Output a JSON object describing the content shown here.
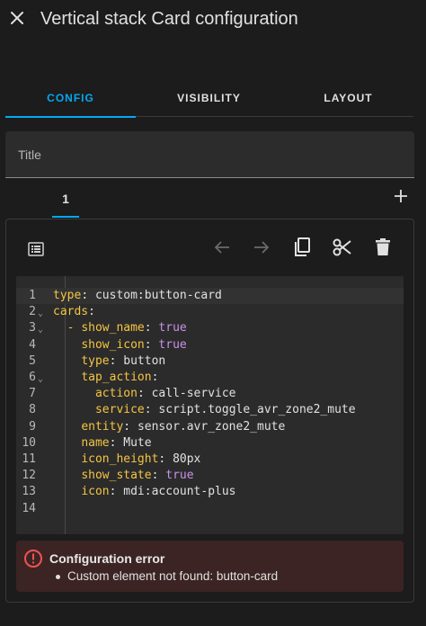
{
  "header": {
    "title": "Vertical stack Card configuration",
    "close_icon": "close-icon"
  },
  "tabs": [
    {
      "label": "CONFIG",
      "active": true
    },
    {
      "label": "VISIBILITY",
      "active": false
    },
    {
      "label": "LAYOUT",
      "active": false
    }
  ],
  "title_field": {
    "placeholder": "Title",
    "value": ""
  },
  "card_tabs": [
    {
      "label": "1",
      "active": true
    }
  ],
  "toolbar": {
    "icons": [
      "list-editor-icon",
      "arrow-left-icon",
      "arrow-right-icon",
      "copy-icon",
      "cut-icon",
      "delete-icon"
    ]
  },
  "editor": {
    "lines": [
      {
        "n": "1",
        "fold": "",
        "indent": "",
        "dash": "",
        "key": "type",
        "value": "custom:button-card",
        "vtype": "str"
      },
      {
        "n": "2",
        "fold": "⌄",
        "indent": "",
        "dash": "",
        "key": "cards",
        "value": "",
        "vtype": "str"
      },
      {
        "n": "3",
        "fold": "⌄",
        "indent": "  ",
        "dash": "- ",
        "key": "show_name",
        "value": "true",
        "vtype": "bool"
      },
      {
        "n": "4",
        "fold": "",
        "indent": "    ",
        "dash": "",
        "key": "show_icon",
        "value": "true",
        "vtype": "bool"
      },
      {
        "n": "5",
        "fold": "",
        "indent": "    ",
        "dash": "",
        "key": "type",
        "value": "button",
        "vtype": "str"
      },
      {
        "n": "6",
        "fold": "⌄",
        "indent": "    ",
        "dash": "",
        "key": "tap_action",
        "value": "",
        "vtype": "str"
      },
      {
        "n": "7",
        "fold": "",
        "indent": "      ",
        "dash": "",
        "key": "action",
        "value": "call-service",
        "vtype": "str"
      },
      {
        "n": "8",
        "fold": "",
        "indent": "      ",
        "dash": "",
        "key": "service",
        "value": "script.toggle_avr_zone2_mute",
        "vtype": "str"
      },
      {
        "n": "9",
        "fold": "",
        "indent": "    ",
        "dash": "",
        "key": "entity",
        "value": "sensor.avr_zone2_mute",
        "vtype": "str"
      },
      {
        "n": "10",
        "fold": "",
        "indent": "    ",
        "dash": "",
        "key": "name",
        "value": "Mute",
        "vtype": "str"
      },
      {
        "n": "11",
        "fold": "",
        "indent": "    ",
        "dash": "",
        "key": "icon_height",
        "value": "80px",
        "vtype": "str"
      },
      {
        "n": "12",
        "fold": "",
        "indent": "    ",
        "dash": "",
        "key": "show_state",
        "value": "true",
        "vtype": "bool"
      },
      {
        "n": "13",
        "fold": "",
        "indent": "    ",
        "dash": "",
        "key": "icon",
        "value": "mdi:account-plus",
        "vtype": "str"
      },
      {
        "n": "14",
        "fold": "",
        "indent": "",
        "dash": "",
        "key": "",
        "value": "",
        "vtype": "str"
      }
    ]
  },
  "error": {
    "title": "Configuration error",
    "items": [
      "Custom element not found: button-card"
    ]
  },
  "colors": {
    "accent": "#03a9f4",
    "yaml_key": "#f4c542",
    "yaml_bool": "#c792ea",
    "error_bg": "#3c2424",
    "error_icon": "#ef5350"
  }
}
